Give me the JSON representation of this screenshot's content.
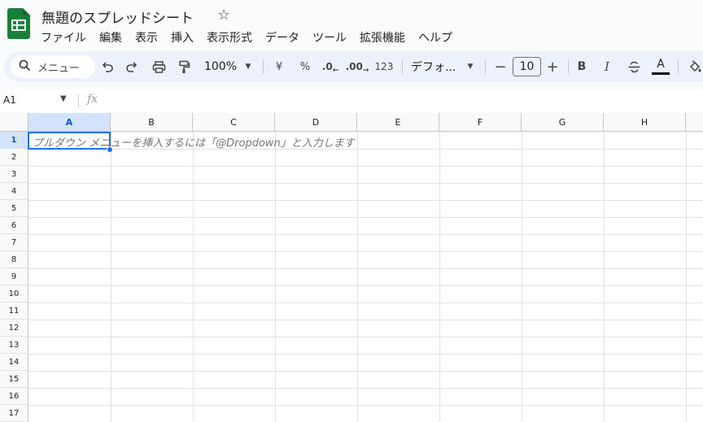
{
  "app": {
    "doc_title": "無題のスプレッドシート",
    "logo_icon": "sheets-logo-icon",
    "star_icon": "star-icon",
    "brand_color": "#188038"
  },
  "menu": [
    "ファイル",
    "編集",
    "表示",
    "挿入",
    "表示形式",
    "データ",
    "ツール",
    "拡張機能",
    "ヘルプ"
  ],
  "toolbar": {
    "search_label": "メニュー",
    "zoom": "100%",
    "currency": "¥",
    "percent": "%",
    "decrease_decimal": ".0",
    "increase_decimal": ".00",
    "number_format": "123",
    "font": "デフォ...",
    "font_size": "10",
    "minus": "−",
    "plus": "+",
    "bold": "B",
    "italic": "I",
    "text_color": "A"
  },
  "formula_bar": {
    "name_box": "A1",
    "fx": "fx"
  },
  "grid": {
    "columns": [
      "A",
      "B",
      "C",
      "D",
      "E",
      "F",
      "G",
      "H"
    ],
    "rows": [
      "1",
      "2",
      "3",
      "4",
      "5",
      "6",
      "7",
      "8",
      "9",
      "10",
      "11",
      "12",
      "13",
      "14",
      "15",
      "16",
      "17"
    ],
    "selected_cell": "A1",
    "cell_hint": "プルダウン メニューを挿入するには「@Dropdown」と入力します",
    "selection_color": "#1a73e8"
  }
}
